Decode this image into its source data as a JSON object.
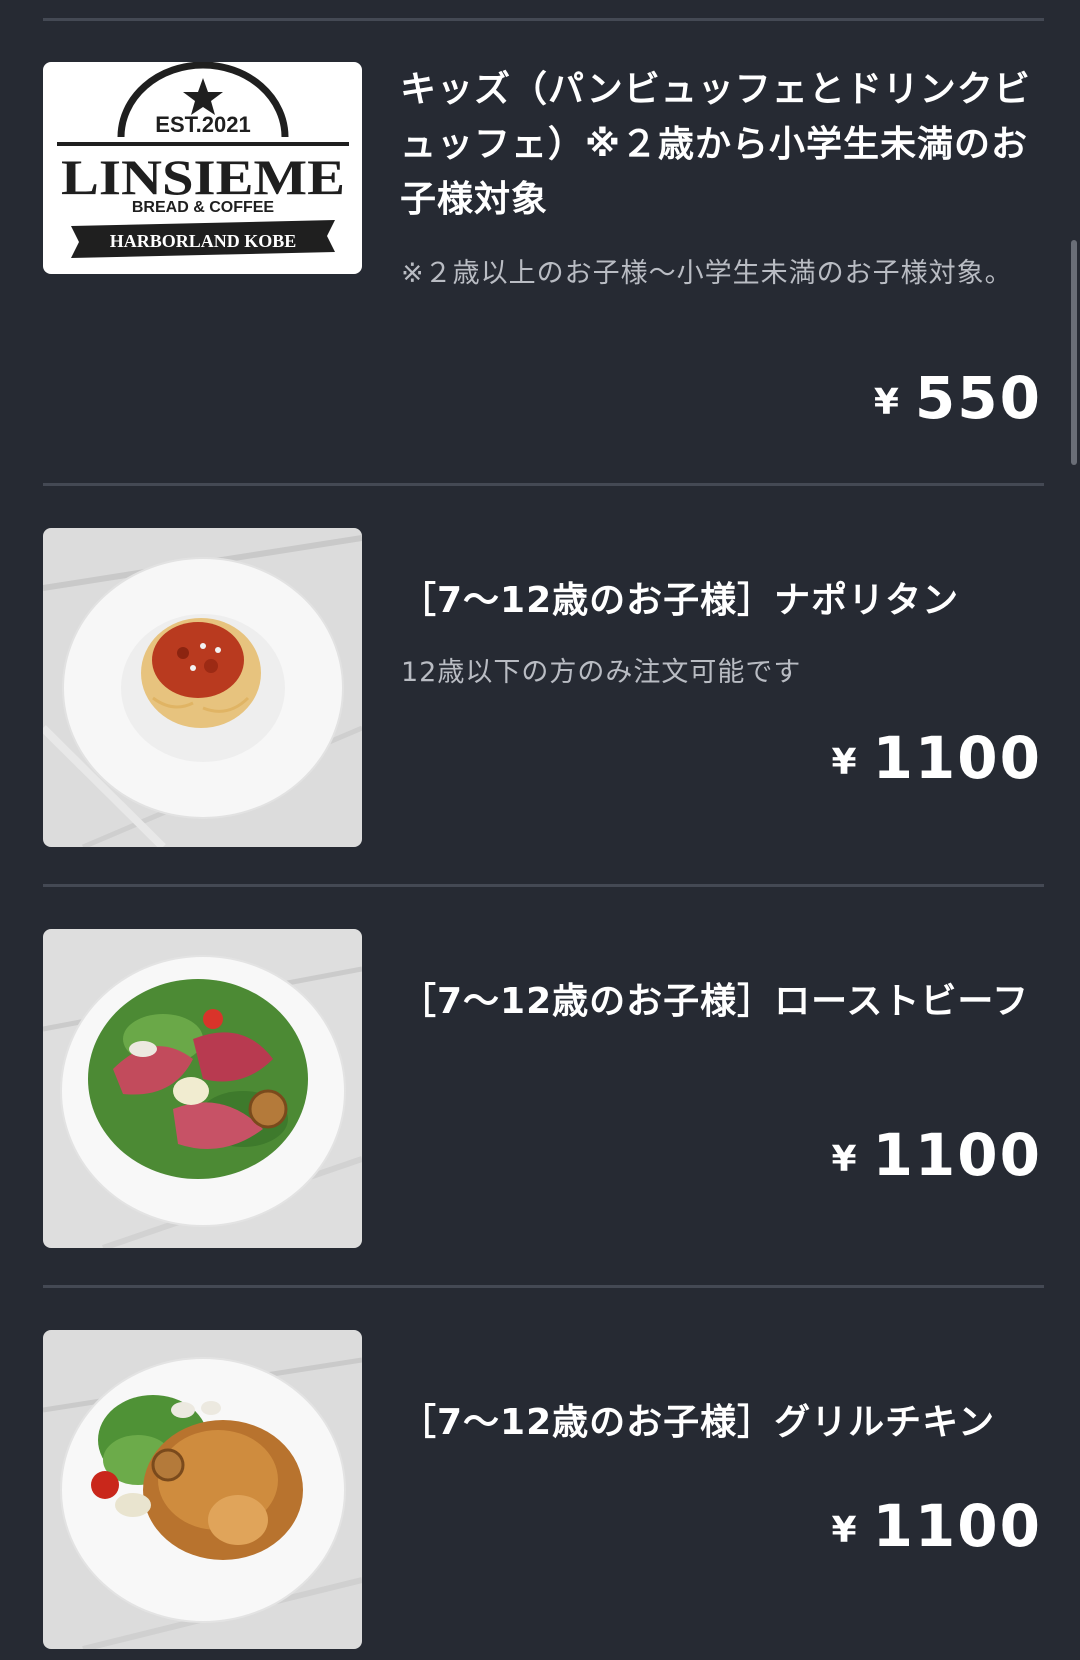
{
  "menu": {
    "items": [
      {
        "title": "キッズ（パンビュッフェとドリンクビュッフェ）※２歳から小学生未満のお子様対象",
        "description": "※２歳以上のお子様〜小学生未満のお子様対象。",
        "currency": "¥",
        "price": "550",
        "image_type": "logo",
        "logo": {
          "est": "EST.2021",
          "name": "LINSIEME",
          "sub": "BREAD & COFFEE",
          "banner": "HARBORLAND KOBE"
        }
      },
      {
        "title": "［7〜12歳のお子様］ナポリタン",
        "description": "12歳以下の方のみ注文可能です",
        "currency": "¥",
        "price": "1100",
        "image_type": "napolitan-pasta-photo"
      },
      {
        "title": "［7〜12歳のお子様］ローストビーフ",
        "description": "",
        "currency": "¥",
        "price": "1100",
        "image_type": "roast-beef-salad-photo"
      },
      {
        "title": "［7〜12歳のお子様］グリルチキン",
        "description": "",
        "currency": "¥",
        "price": "1100",
        "image_type": "grilled-chicken-photo"
      }
    ]
  },
  "colors": {
    "background": "#262a33",
    "divider": "#444954",
    "text": "#ffffff",
    "description_text": "#b9bcc3"
  }
}
